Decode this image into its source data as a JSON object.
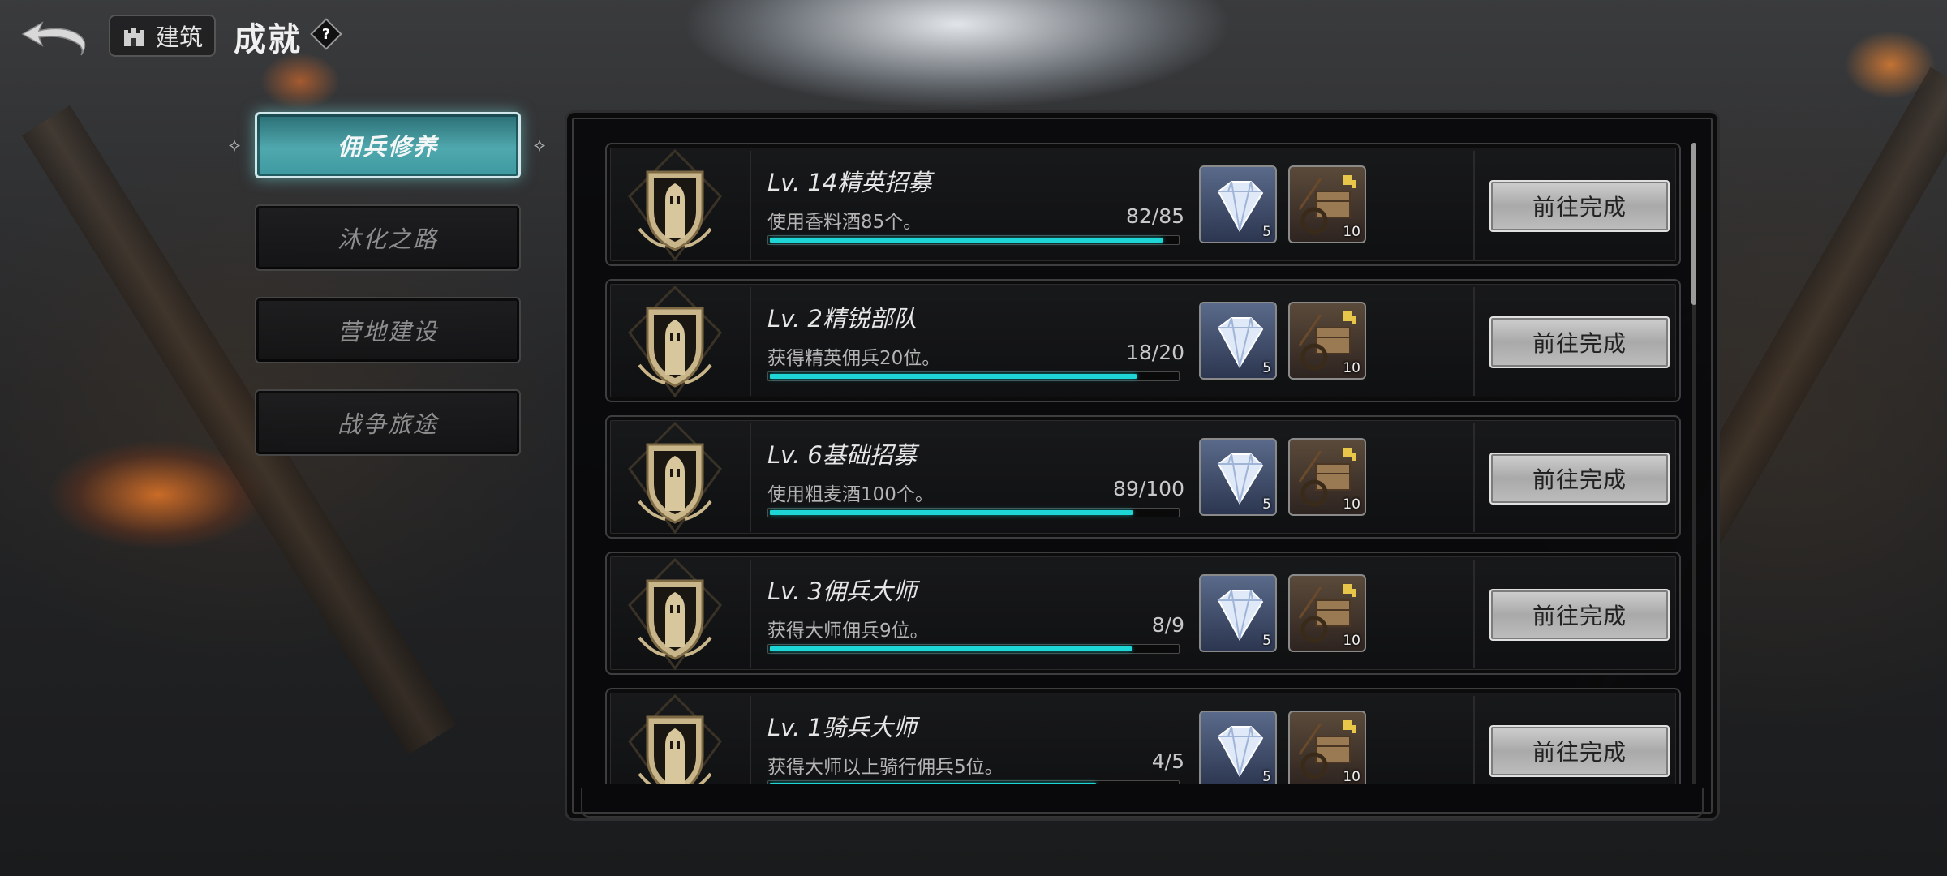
{
  "header": {
    "back_icon": "back-arrow-icon",
    "building_label": "建筑",
    "title": "成就",
    "help_label": "?"
  },
  "tabs": [
    {
      "label": "佣兵修养",
      "active": true
    },
    {
      "label": "沐化之路",
      "active": false
    },
    {
      "label": "营地建设",
      "active": false
    },
    {
      "label": "战争旅途",
      "active": false
    }
  ],
  "achievements": [
    {
      "title": "Lv. 14精英招募",
      "desc": "使用香料酒85个。",
      "progress_text": "82/85",
      "progress": 0.965,
      "rewards": [
        {
          "icon": "diamond-icon",
          "count": "5"
        },
        {
          "icon": "cart-icon",
          "count": "10"
        }
      ],
      "button": "前往完成"
    },
    {
      "title": "Lv. 2精锐部队",
      "desc": "获得精英佣兵20位。",
      "progress_text": "18/20",
      "progress": 0.9,
      "rewards": [
        {
          "icon": "diamond-icon",
          "count": "5"
        },
        {
          "icon": "cart-icon",
          "count": "10"
        }
      ],
      "button": "前往完成"
    },
    {
      "title": "Lv. 6基础招募",
      "desc": "使用粗麦酒100个。",
      "progress_text": "89/100",
      "progress": 0.89,
      "rewards": [
        {
          "icon": "diamond-icon",
          "count": "5"
        },
        {
          "icon": "cart-icon",
          "count": "10"
        }
      ],
      "button": "前往完成"
    },
    {
      "title": "Lv. 3佣兵大师",
      "desc": "获得大师佣兵9位。",
      "progress_text": "8/9",
      "progress": 0.889,
      "rewards": [
        {
          "icon": "diamond-icon",
          "count": "5"
        },
        {
          "icon": "cart-icon",
          "count": "10"
        }
      ],
      "button": "前往完成"
    },
    {
      "title": "Lv. 1骑兵大师",
      "desc": "获得大师以上骑行佣兵5位。",
      "progress_text": "4/5",
      "progress": 0.8,
      "rewards": [
        {
          "icon": "diamond-icon",
          "count": "5"
        },
        {
          "icon": "cart-icon",
          "count": "10"
        }
      ],
      "button": "前往完成"
    }
  ],
  "colors": {
    "progress_fill": "#1fd6d6",
    "active_tab": "#4fa8ae"
  }
}
